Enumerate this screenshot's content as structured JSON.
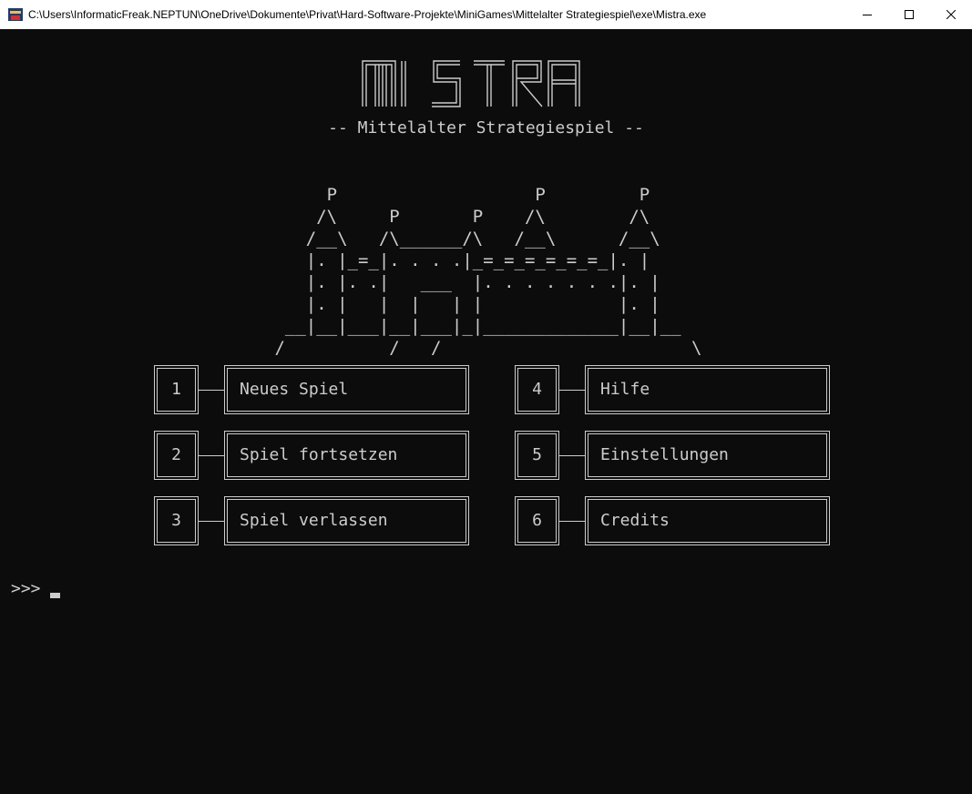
{
  "window": {
    "title": "C:\\Users\\InformaticFreak.NEPTUN\\OneDrive\\Dokumente\\Privat\\Hard-Software-Projekte\\MiniGames\\Mittelalter Strategiespiel\\exe\\Mistra.exe",
    "icon": "console-app-icon",
    "controls": [
      "minimize-icon",
      "maximize-icon",
      "close-icon"
    ]
  },
  "logo": {
    "text": "MISTRA",
    "subtitle": "-- Mittelalter Strategiespiel --"
  },
  "castle_ascii": [
    "      P                   P         P",
    "     /\\     P       P    /\\        /\\",
    "    /__\\   /\\______/\\   /__\\      /__\\",
    "    |. |_=_|. . . .|_=_=_=_=_=_=_|. |",
    "    |. |. .|   ___  |. . . . . . .|. |",
    "    |. |   |  |   | |             |. |",
    "  __|__|___|__|___|_|_____________|__|__",
    " /          /   /                        \\"
  ],
  "menu": {
    "items": [
      {
        "number": "1",
        "label": "Neues Spiel"
      },
      {
        "number": "2",
        "label": "Spiel fortsetzen"
      },
      {
        "number": "3",
        "label": "Spiel verlassen"
      },
      {
        "number": "4",
        "label": "Hilfe"
      },
      {
        "number": "5",
        "label": "Einstellungen"
      },
      {
        "number": "6",
        "label": "Credits"
      }
    ]
  },
  "prompt": {
    "text": ">>> "
  },
  "colors": {
    "background": "#0c0c0c",
    "foreground": "#cccccc",
    "titlebar": "#ffffff"
  }
}
